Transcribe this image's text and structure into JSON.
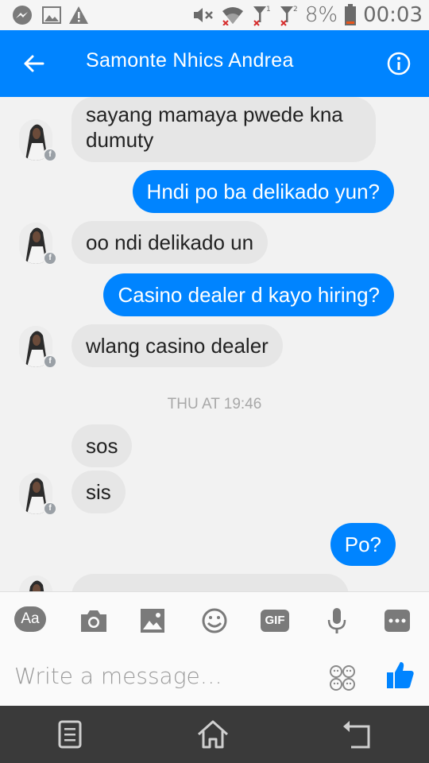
{
  "status": {
    "battery_pct": "8%",
    "time": "00:03",
    "sim1": "1",
    "sim2": "2"
  },
  "header": {
    "title": "Samonte Nhics Andrea"
  },
  "messages": {
    "m1": "sayang mamaya pwede kna",
    "m1b": "dumuty",
    "m2": "Hndi po ba delikado yun?",
    "m3": "oo ndi delikado un",
    "m4": "Casino dealer d kayo hiring?",
    "m5": "wlang casino dealer",
    "m6": "sos",
    "m7": "sis",
    "m8": "Po?"
  },
  "divider": {
    "label": "THU AT 19:46"
  },
  "toolbar": {
    "aa_label": "Aa",
    "gif_label": "GIF"
  },
  "composer": {
    "placeholder": "Write a message…"
  },
  "colors": {
    "accent": "#0084ff",
    "incoming_bubble": "#e6e6e6",
    "nav_bg": "#3a3a3a"
  },
  "icons": [
    "messenger-icon",
    "gallery-icon",
    "warning-icon",
    "mute-icon",
    "wifi-icon",
    "signal-icon",
    "battery-icon",
    "back-arrow-icon",
    "info-icon",
    "camera-icon",
    "image-icon",
    "emoji-icon",
    "gif-icon",
    "mic-icon",
    "more-icon",
    "sticker-icon",
    "like-icon",
    "menu-icon",
    "home-icon",
    "back-nav-icon"
  ]
}
